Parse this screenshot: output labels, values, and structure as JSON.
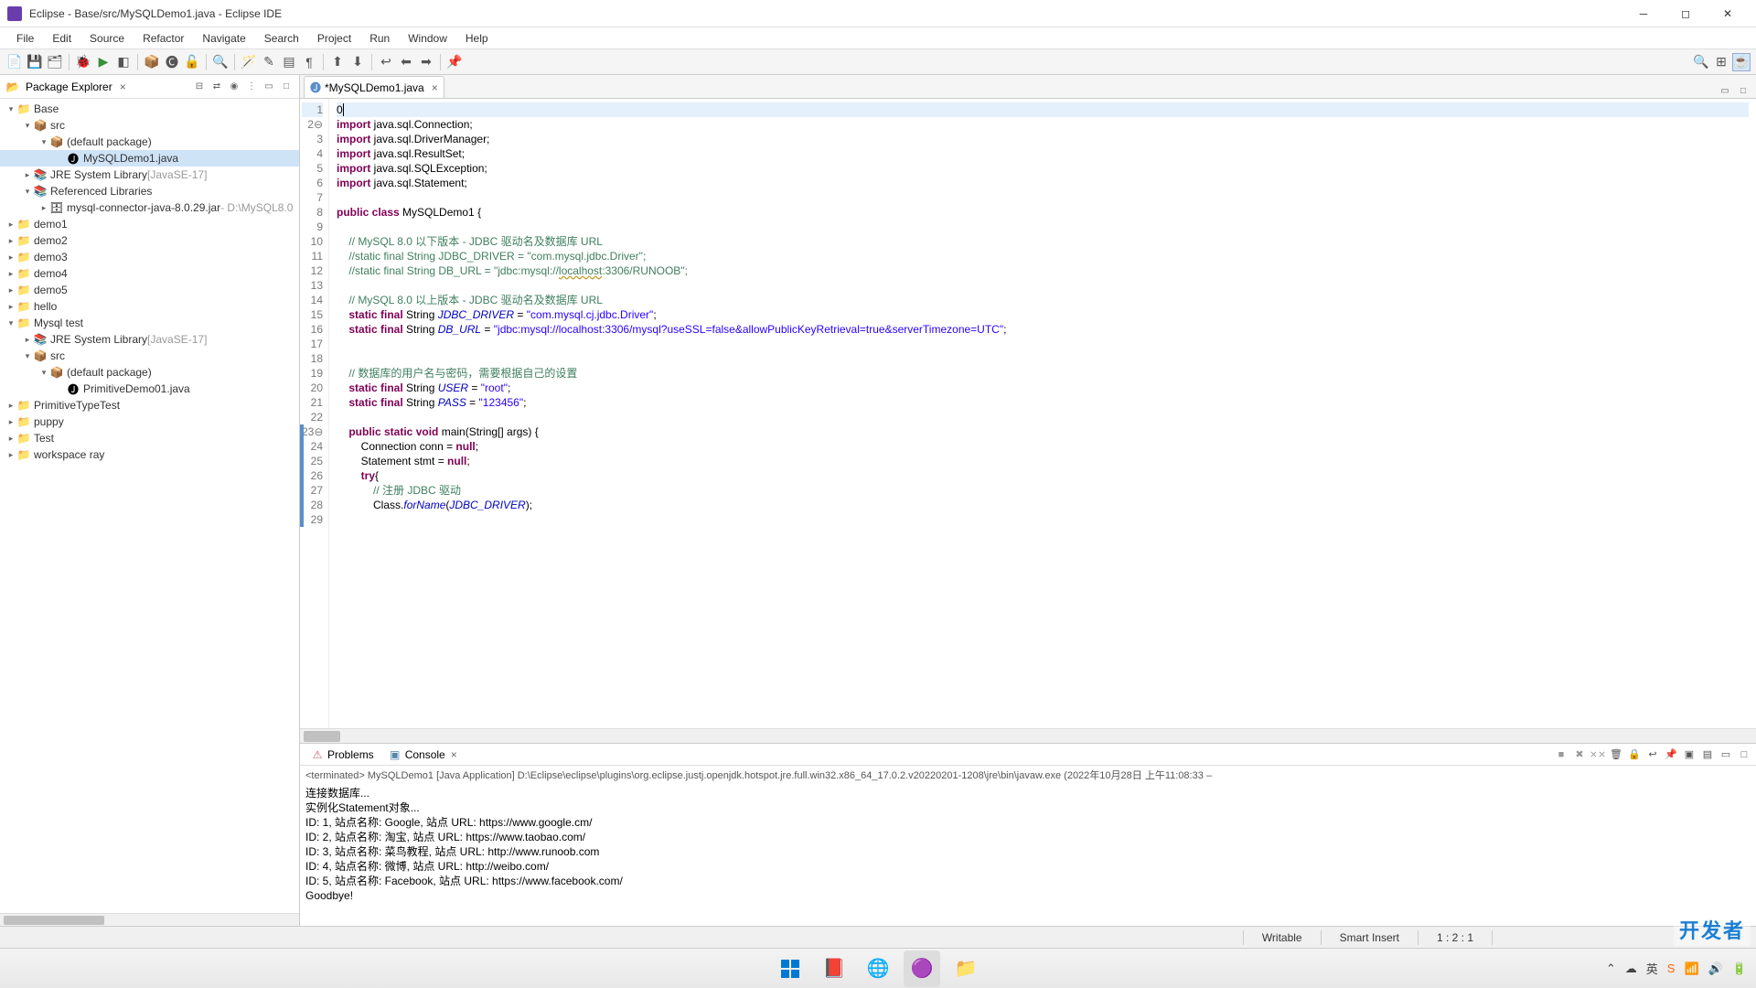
{
  "window": {
    "title": "Eclipse - Base/src/MySQLDemo1.java - Eclipse IDE"
  },
  "menu": [
    "File",
    "Edit",
    "Source",
    "Refactor",
    "Navigate",
    "Search",
    "Project",
    "Run",
    "Window",
    "Help"
  ],
  "package_explorer": {
    "title": "Package Explorer",
    "tree": [
      {
        "indent": 0,
        "toggle": "▾",
        "icon": "project",
        "label": "Base"
      },
      {
        "indent": 1,
        "toggle": "▾",
        "icon": "src",
        "label": "src"
      },
      {
        "indent": 2,
        "toggle": "▾",
        "icon": "package",
        "label": "(default package)"
      },
      {
        "indent": 3,
        "toggle": "",
        "icon": "java",
        "label": "MySQLDemo1.java",
        "selected": true
      },
      {
        "indent": 1,
        "toggle": "▸",
        "icon": "library",
        "label": "JRE System Library",
        "dim": " [JavaSE-17]"
      },
      {
        "indent": 1,
        "toggle": "▾",
        "icon": "library",
        "label": "Referenced Libraries"
      },
      {
        "indent": 2,
        "toggle": "▸",
        "icon": "jar",
        "label": "mysql-connector-java-8.0.29.jar",
        "dim": " - D:\\MySQL8.0"
      },
      {
        "indent": 0,
        "toggle": "▸",
        "icon": "project",
        "label": "demo1"
      },
      {
        "indent": 0,
        "toggle": "▸",
        "icon": "project",
        "label": "demo2"
      },
      {
        "indent": 0,
        "toggle": "▸",
        "icon": "project",
        "label": "demo3"
      },
      {
        "indent": 0,
        "toggle": "▸",
        "icon": "project",
        "label": "demo4"
      },
      {
        "indent": 0,
        "toggle": "▸",
        "icon": "project",
        "label": "demo5"
      },
      {
        "indent": 0,
        "toggle": "▸",
        "icon": "project",
        "label": "hello"
      },
      {
        "indent": 0,
        "toggle": "▾",
        "icon": "project",
        "label": "Mysql test"
      },
      {
        "indent": 1,
        "toggle": "▸",
        "icon": "library",
        "label": "JRE System Library",
        "dim": " [JavaSE-17]"
      },
      {
        "indent": 1,
        "toggle": "▾",
        "icon": "src",
        "label": "src"
      },
      {
        "indent": 2,
        "toggle": "▾",
        "icon": "package",
        "label": "(default package)"
      },
      {
        "indent": 3,
        "toggle": "",
        "icon": "java",
        "label": "PrimitiveDemo01.java"
      },
      {
        "indent": 0,
        "toggle": "▸",
        "icon": "project",
        "label": "PrimitiveTypeTest"
      },
      {
        "indent": 0,
        "toggle": "▸",
        "icon": "project",
        "label": "puppy"
      },
      {
        "indent": 0,
        "toggle": "▸",
        "icon": "project",
        "label": "Test"
      },
      {
        "indent": 0,
        "toggle": "▸",
        "icon": "project",
        "label": "workspace ray"
      }
    ]
  },
  "editor": {
    "tab_title": "*MySQLDemo1.java",
    "code_lines": [
      {
        "n": 1,
        "hl": true,
        "spans": [
          {
            "t": "0",
            "cls": ""
          }
        ],
        "caret": true
      },
      {
        "n": 2,
        "fold": true,
        "spans": [
          {
            "t": "import",
            "cls": "kw"
          },
          {
            "t": " java.sql.Connection;",
            "cls": ""
          }
        ]
      },
      {
        "n": 3,
        "spans": [
          {
            "t": "import",
            "cls": "kw"
          },
          {
            "t": " java.sql.DriverManager;",
            "cls": ""
          }
        ]
      },
      {
        "n": 4,
        "spans": [
          {
            "t": "import",
            "cls": "kw"
          },
          {
            "t": " java.sql.ResultSet;",
            "cls": ""
          }
        ]
      },
      {
        "n": 5,
        "spans": [
          {
            "t": "import",
            "cls": "kw"
          },
          {
            "t": " java.sql.SQLException;",
            "cls": ""
          }
        ]
      },
      {
        "n": 6,
        "spans": [
          {
            "t": "import",
            "cls": "kw"
          },
          {
            "t": " java.sql.Statement;",
            "cls": ""
          }
        ]
      },
      {
        "n": 7,
        "spans": [
          {
            "t": "",
            "cls": ""
          }
        ]
      },
      {
        "n": 8,
        "spans": [
          {
            "t": "public class",
            "cls": "kw"
          },
          {
            "t": " MySQLDemo1 {",
            "cls": ""
          }
        ]
      },
      {
        "n": 9,
        "spans": [
          {
            "t": "",
            "cls": ""
          }
        ]
      },
      {
        "n": 10,
        "spans": [
          {
            "t": "    // MySQL 8.0 以下版本 - JDBC 驱动名及数据库 URL",
            "cls": "cmt"
          }
        ]
      },
      {
        "n": 11,
        "spans": [
          {
            "t": "    //static final String JDBC_DRIVER = \"com.mysql.jdbc.Driver\";",
            "cls": "cmt"
          }
        ]
      },
      {
        "n": 12,
        "spans": [
          {
            "t": "    //static final String DB_URL = \"jdbc:mysql://",
            "cls": "cmt"
          },
          {
            "t": "localhost",
            "cls": "cmt squiggle"
          },
          {
            "t": ":3306/RUNOOB\";",
            "cls": "cmt"
          }
        ]
      },
      {
        "n": 13,
        "spans": [
          {
            "t": "",
            "cls": ""
          }
        ]
      },
      {
        "n": 14,
        "spans": [
          {
            "t": "    // MySQL 8.0 以上版本 - JDBC 驱动名及数据库 URL",
            "cls": "cmt"
          }
        ]
      },
      {
        "n": 15,
        "spans": [
          {
            "t": "    ",
            "cls": ""
          },
          {
            "t": "static final",
            "cls": "kw"
          },
          {
            "t": " String ",
            "cls": ""
          },
          {
            "t": "JDBC_DRIVER",
            "cls": "itl"
          },
          {
            "t": " = ",
            "cls": ""
          },
          {
            "t": "\"com.mysql.cj.jdbc.Driver\"",
            "cls": "str"
          },
          {
            "t": ";",
            "cls": ""
          }
        ]
      },
      {
        "n": 16,
        "spans": [
          {
            "t": "    ",
            "cls": ""
          },
          {
            "t": "static final",
            "cls": "kw"
          },
          {
            "t": " String ",
            "cls": ""
          },
          {
            "t": "DB_URL",
            "cls": "itl"
          },
          {
            "t": " = ",
            "cls": ""
          },
          {
            "t": "\"jdbc:mysql://localhost:3306/mysql?useSSL=false&allowPublicKeyRetrieval=true&serverTimezone=UTC\"",
            "cls": "str"
          },
          {
            "t": ";",
            "cls": ""
          }
        ]
      },
      {
        "n": 17,
        "spans": [
          {
            "t": "",
            "cls": ""
          }
        ]
      },
      {
        "n": 18,
        "spans": [
          {
            "t": "",
            "cls": ""
          }
        ]
      },
      {
        "n": 19,
        "spans": [
          {
            "t": "    // 数据库的用户名与密码，需要根据自己的设置",
            "cls": "cmt"
          }
        ]
      },
      {
        "n": 20,
        "spans": [
          {
            "t": "    ",
            "cls": ""
          },
          {
            "t": "static final",
            "cls": "kw"
          },
          {
            "t": " String ",
            "cls": ""
          },
          {
            "t": "USER",
            "cls": "itl"
          },
          {
            "t": " = ",
            "cls": ""
          },
          {
            "t": "\"root\"",
            "cls": "str"
          },
          {
            "t": ";",
            "cls": ""
          }
        ]
      },
      {
        "n": 21,
        "spans": [
          {
            "t": "    ",
            "cls": ""
          },
          {
            "t": "static final",
            "cls": "kw"
          },
          {
            "t": " String ",
            "cls": ""
          },
          {
            "t": "PASS",
            "cls": "itl"
          },
          {
            "t": " = ",
            "cls": ""
          },
          {
            "t": "\"123456\"",
            "cls": "str"
          },
          {
            "t": ";",
            "cls": ""
          }
        ]
      },
      {
        "n": 22,
        "spans": [
          {
            "t": "",
            "cls": ""
          }
        ]
      },
      {
        "n": 23,
        "fold": true,
        "spans": [
          {
            "t": "    ",
            "cls": ""
          },
          {
            "t": "public static void",
            "cls": "kw"
          },
          {
            "t": " main(String[] args) {",
            "cls": ""
          }
        ]
      },
      {
        "n": 24,
        "spans": [
          {
            "t": "        Connection conn = ",
            "cls": ""
          },
          {
            "t": "null",
            "cls": "kw"
          },
          {
            "t": ";",
            "cls": ""
          }
        ]
      },
      {
        "n": 25,
        "spans": [
          {
            "t": "        Statement stmt = ",
            "cls": ""
          },
          {
            "t": "null",
            "cls": "kw"
          },
          {
            "t": ";",
            "cls": ""
          }
        ]
      },
      {
        "n": 26,
        "spans": [
          {
            "t": "        ",
            "cls": ""
          },
          {
            "t": "try",
            "cls": "kw"
          },
          {
            "t": "{",
            "cls": ""
          }
        ]
      },
      {
        "n": 27,
        "spans": [
          {
            "t": "            // 注册 JDBC 驱动",
            "cls": "cmt"
          }
        ]
      },
      {
        "n": 28,
        "spans": [
          {
            "t": "            Class.",
            "cls": ""
          },
          {
            "t": "forName",
            "cls": "itl"
          },
          {
            "t": "(",
            "cls": ""
          },
          {
            "t": "JDBC_DRIVER",
            "cls": "itl"
          },
          {
            "t": ");",
            "cls": ""
          }
        ]
      },
      {
        "n": 29,
        "spans": [
          {
            "t": "",
            "cls": ""
          }
        ]
      }
    ]
  },
  "bottom": {
    "problems_tab": "Problems",
    "console_tab": "Console",
    "console_header": "<terminated> MySQLDemo1 [Java Application] D:\\Eclipse\\eclipse\\plugins\\org.eclipse.justj.openjdk.hotspot.jre.full.win32.x86_64_17.0.2.v20220201-1208\\jre\\bin\\javaw.exe (2022年10月28日 上午11:08:33 –",
    "console_lines": [
      "连接数据库...",
      " 实例化Statement对象...",
      "ID: 1, 站点名称: Google, 站点 URL: https://www.google.cm/",
      "ID: 2, 站点名称: 淘宝, 站点 URL: https://www.taobao.com/",
      "ID: 3, 站点名称: 菜鸟教程, 站点 URL: http://www.runoob.com",
      "ID: 4, 站点名称: 微博, 站点 URL: http://weibo.com/",
      "ID: 5, 站点名称: Facebook, 站点 URL: https://www.facebook.com/",
      "Goodbye!"
    ]
  },
  "status": {
    "writable": "Writable",
    "insert": "Smart Insert",
    "cursor": "1 : 2 : 1"
  },
  "tray": {
    "ime": "英",
    "time": ""
  },
  "watermark": "开发者"
}
